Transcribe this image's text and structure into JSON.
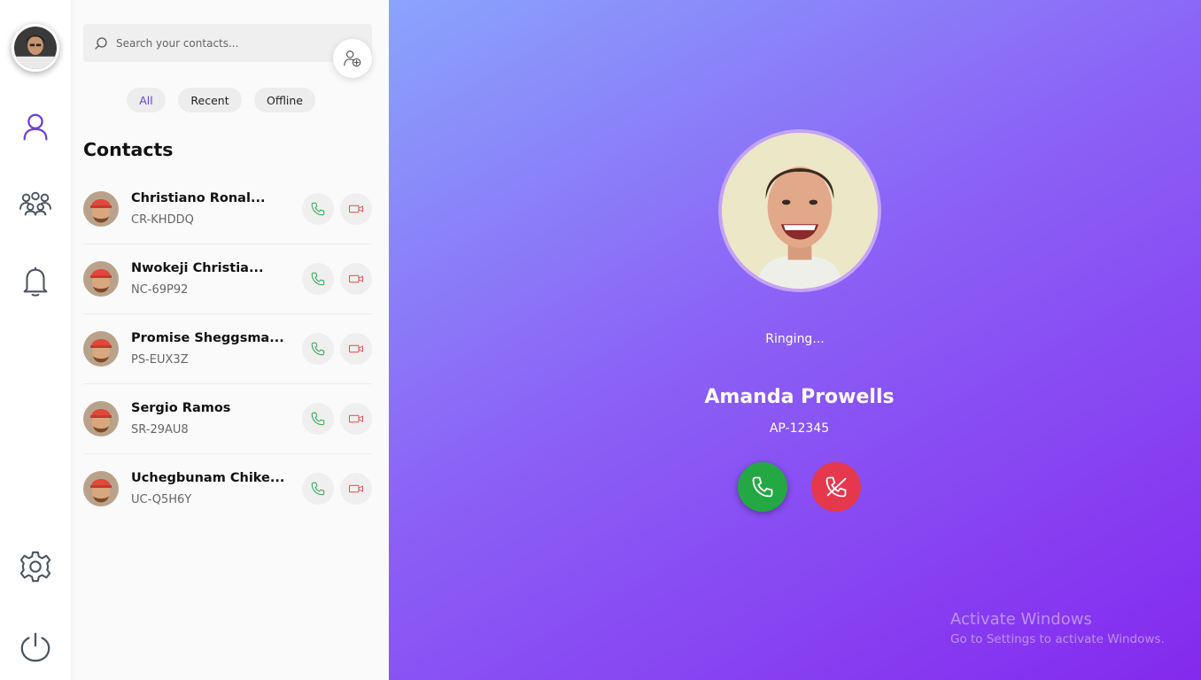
{
  "rail": {
    "items": [
      {
        "icon": "user-icon",
        "label": "profile"
      },
      {
        "icon": "group-icon",
        "label": "groups"
      },
      {
        "icon": "bell-icon",
        "label": "notifications"
      },
      {
        "icon": "gear-icon",
        "label": "settings"
      },
      {
        "icon": "power-icon",
        "label": "logout"
      }
    ],
    "active_color": "#6b3fd6"
  },
  "search": {
    "placeholder": "Search your contacts..."
  },
  "filters": [
    "All",
    "Recent",
    "Offline"
  ],
  "contacts_title": "Contacts",
  "contacts": [
    {
      "name": "Christiano Ronal...",
      "id": "CR-KHDDQ"
    },
    {
      "name": "Nwokeji Christia...",
      "id": "NC-69P92"
    },
    {
      "name": "Promise Sheggsma...",
      "id": "PS-EUX3Z"
    },
    {
      "name": "Sergio Ramos",
      "id": "SR-29AU8"
    },
    {
      "name": "Uchegbunam Chike...",
      "id": "UC-Q5H6Y"
    }
  ],
  "call": {
    "status": "Ringing...",
    "caller_name": "Amanda Prowells",
    "caller_id": "AP-12345",
    "accept_color": "#24a844",
    "decline_color": "#e5384d"
  },
  "watermark": {
    "title": "Activate Windows",
    "subtitle": "Go to Settings to activate Windows."
  }
}
